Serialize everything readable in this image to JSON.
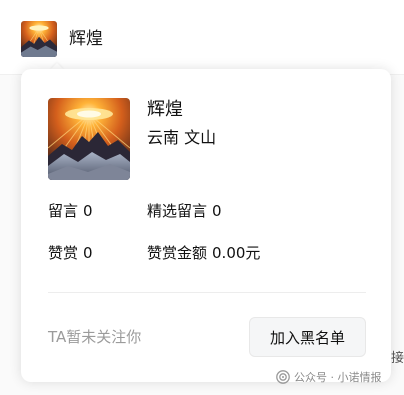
{
  "header": {
    "name": "辉煌",
    "avatar_icon": "sunburst-mountain-avatar"
  },
  "profile_popover": {
    "name": "辉煌",
    "location": "云南 文山",
    "avatar_icon": "sunburst-mountain-avatar",
    "stats": {
      "comments_label": "留言",
      "comments_value": "0",
      "featured_comments_label": "精选留言",
      "featured_comments_value": "0",
      "likes_label": "赞赏",
      "likes_value": "0",
      "tip_amount_label": "赞赏金额",
      "tip_amount_value": "0.00元"
    },
    "follow_status": "TA暂未关注你",
    "blacklist_button_label": "加入黑名单"
  },
  "background": {
    "right_edge_text": "接"
  },
  "watermark": {
    "text": "公众号 · 小诺情报",
    "icon": "wechat-official-account-icon"
  }
}
